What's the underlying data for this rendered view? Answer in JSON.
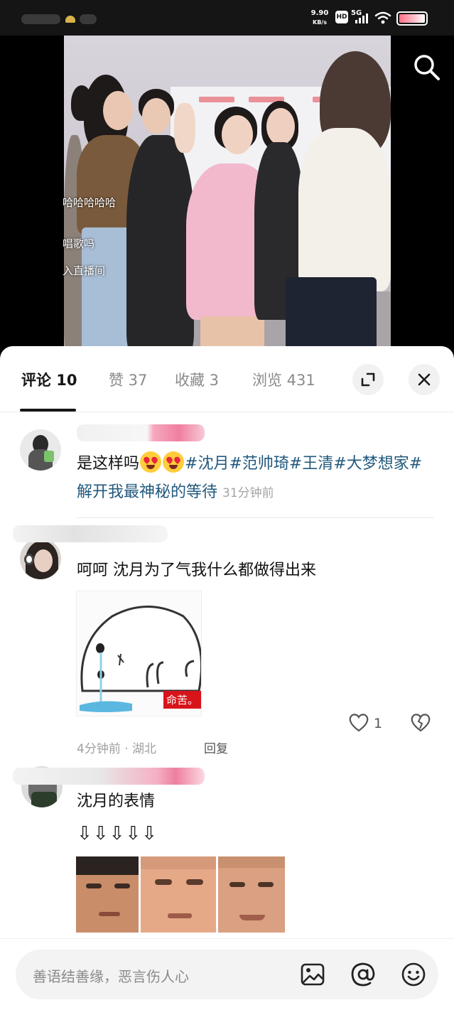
{
  "status_bar": {
    "speed_value": "9.90",
    "speed_unit": "KB/s",
    "hd_label": "HD",
    "network_label": "5G",
    "icons": [
      "hd-icon",
      "signal-icon",
      "wifi-icon",
      "battery-icon"
    ]
  },
  "video": {
    "overlay_lines": [
      "哈哈哈哈哈",
      "唱歌吗",
      "入直播间"
    ],
    "search_icon": "search-icon"
  },
  "tabs": [
    {
      "label": "评论 10",
      "active": true
    },
    {
      "label": "赞 37",
      "active": false
    },
    {
      "label": "收藏 3",
      "active": false
    },
    {
      "label": "浏览 431",
      "active": false
    }
  ],
  "sheet_buttons": {
    "expand_icon": "expand-icon",
    "close_icon": "close-icon"
  },
  "comments": [
    {
      "text_lead": "是这样吗",
      "emoji": [
        "heart-eyes-emoji",
        "heart-eyes-emoji"
      ],
      "hashtags": [
        "#沈月",
        "#范帅琦",
        "#王清",
        "#大梦想家",
        "#解开我最神秘的等待"
      ],
      "time": "31分钟前"
    },
    {
      "text": "呵呵 沈月为了气我什么都做得出来",
      "sticker_caption": "命苦。",
      "time": "4分钟前",
      "location": "湖北",
      "separator": "·",
      "reply_label": "回复",
      "like_count": "1"
    },
    {
      "text": "沈月的表情",
      "arrows": "⇩⇩⇩⇩⇩"
    }
  ],
  "input_bar": {
    "placeholder": "善语结善缘，恶言伤人心",
    "icons": [
      "image-icon",
      "at-icon",
      "emoji-icon"
    ]
  },
  "colors": {
    "hashtag": "#22597e",
    "sticker_caption_bg": "#d8141b",
    "battery_fill": "#ff6f86"
  }
}
